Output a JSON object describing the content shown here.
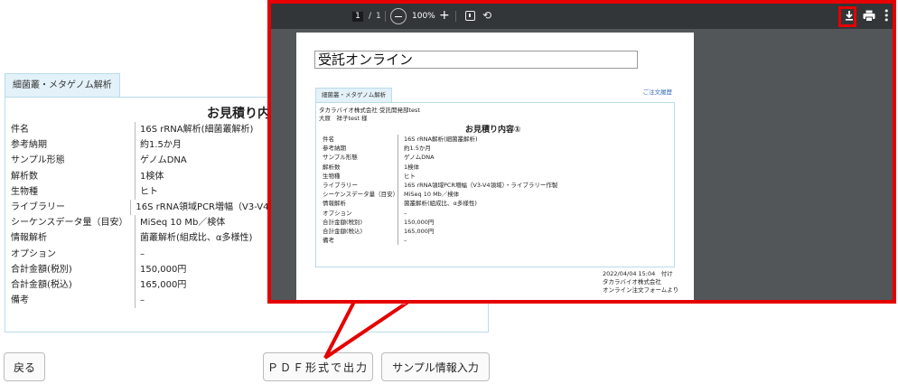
{
  "background": {
    "tab_label": "細菌叢・メタゲノム解析",
    "heading": "お見積り内",
    "rows": [
      {
        "label": "件名",
        "value": "16S rRNA解析(細菌叢解析)"
      },
      {
        "label": "参考納期",
        "value": "約1.5か月"
      },
      {
        "label": "サンプル形態",
        "value": "ゲノムDNA"
      },
      {
        "label": "解析数",
        "value": "1検体"
      },
      {
        "label": "生物種",
        "value": "ヒト"
      },
      {
        "label": "ライブラリー",
        "value": "16S rRNA領域PCR増幅（V3-V4領"
      },
      {
        "label": "シーケンスデータ量（目安）",
        "value": "MiSeq 10 Mb／検体"
      },
      {
        "label": "情報解析",
        "value": "菌叢解析(組成比、α多様性)"
      },
      {
        "label": "オプション",
        "value": "–"
      },
      {
        "label": "合計金額(税別)",
        "value": "150,000円"
      },
      {
        "label": "合計金額(税込)",
        "value": "165,000円"
      },
      {
        "label": "備考",
        "value": "–"
      }
    ],
    "buttons": {
      "back": "戻る",
      "pdf": "ＰＤＦ形式で出力",
      "sample": "サンプル情報入力"
    }
  },
  "viewer": {
    "page_current": "1",
    "page_separator": "/",
    "page_total": "1",
    "zoom": "100%",
    "zoom_in": "+",
    "icons": [
      "zoom-out-icon",
      "zoom-in-icon",
      "fit-page-icon",
      "rotate-icon",
      "download-icon",
      "print-icon",
      "more-icon"
    ],
    "accent_color": "#e60000"
  },
  "document": {
    "title": "受託オンライン",
    "history_link": "ご注文履歴",
    "tab_label": "細菌叢・メタゲノム解析",
    "company": "タカラバイオ株式会社 受託開発部test",
    "person": "大原　祥子test 様",
    "heading": "お見積り内容①",
    "rows": [
      {
        "label": "件名",
        "value": "16S rRNA解析(細菌叢解析)"
      },
      {
        "label": "参考納期",
        "value": "約1.5か月"
      },
      {
        "label": "サンプル形態",
        "value": "ゲノムDNA"
      },
      {
        "label": "解析数",
        "value": "1検体"
      },
      {
        "label": "生物種",
        "value": "ヒト"
      },
      {
        "label": "ライブラリー",
        "value": "16S rRNA領域PCR増幅（V3-V4領域）・ライブラリー作製"
      },
      {
        "label": "シーケンスデータ量（目安）",
        "value": "MiSeq 10 Mb／検体"
      },
      {
        "label": "情報解析",
        "value": "菌叢解析(組成比、α多様性)"
      },
      {
        "label": "オプション",
        "value": "–"
      },
      {
        "label": "合計金額(税別)",
        "value": "150,000円"
      },
      {
        "label": "合計金額(税込)",
        "value": "165,000円"
      },
      {
        "label": "備考",
        "value": "–"
      }
    ],
    "footer": {
      "date": "2022/04/04 15:04　付け",
      "company": "タカラバイオ株式会社",
      "source": "オンライン注文フォームより"
    }
  }
}
